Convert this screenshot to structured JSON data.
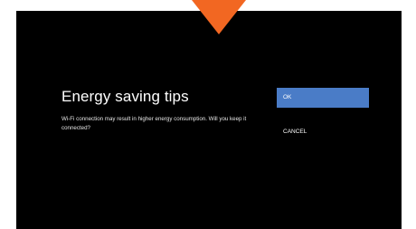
{
  "colors": {
    "screen_background": "#000000",
    "selected_option_background": "#4a7cc7",
    "pointer_accent": "#f26722",
    "text_primary": "#ffffff"
  },
  "pointer": {
    "icon": "down-pointer-arrow-icon"
  },
  "dialog": {
    "title": "Energy saving tips",
    "message": "Wi-Fi connection may result in higher energy consumption. Will you keep it connected?",
    "options": {
      "ok_label": "OK",
      "cancel_label": "CANCEL",
      "selected": "OK"
    }
  }
}
